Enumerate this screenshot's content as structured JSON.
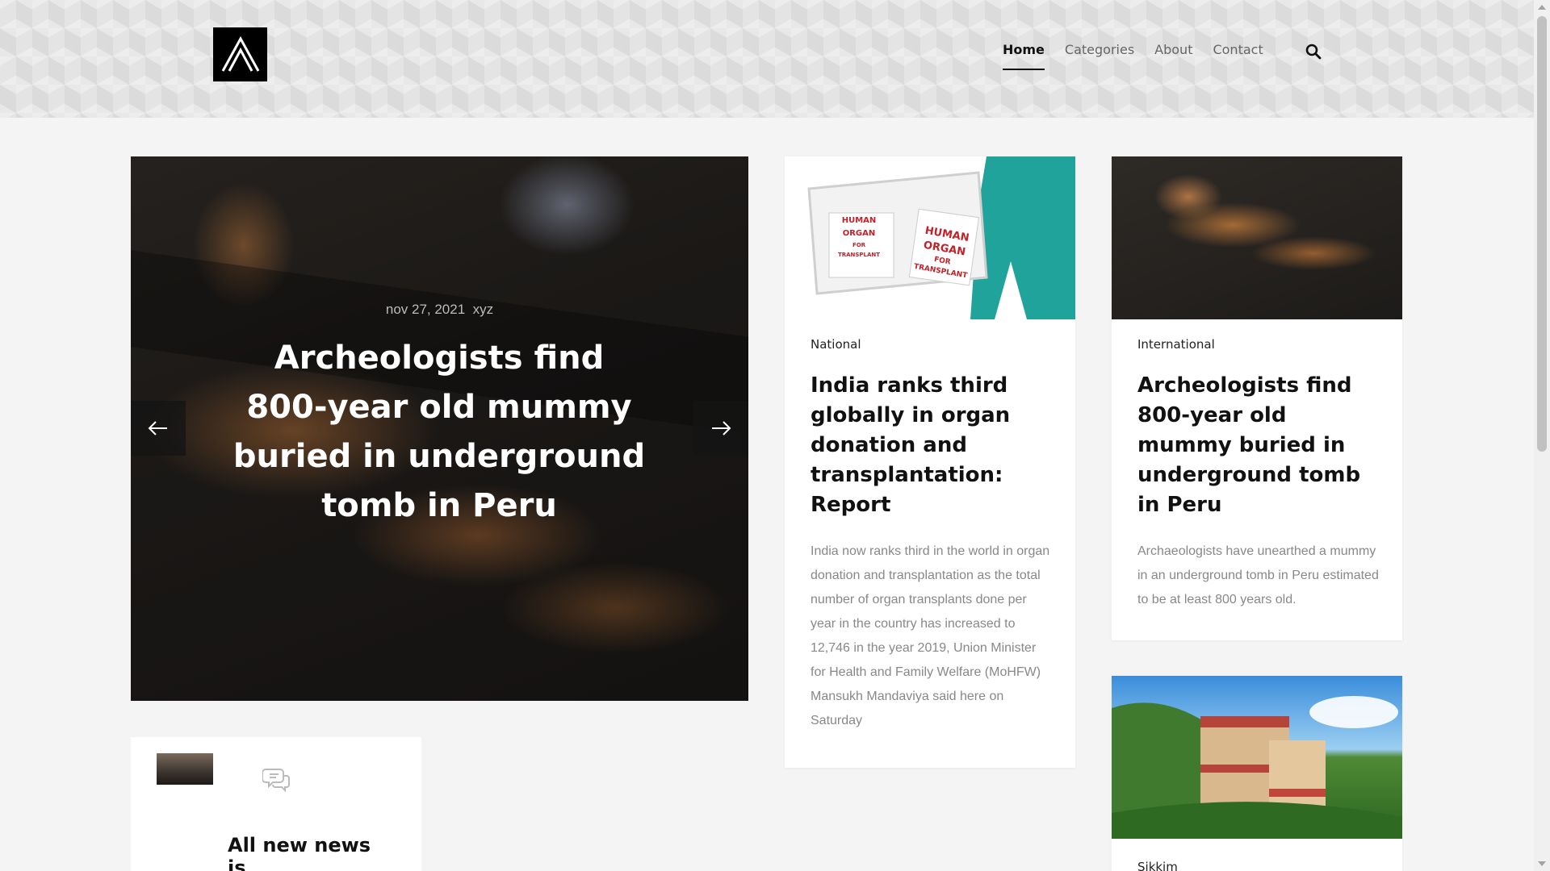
{
  "nav": {
    "items": [
      {
        "label": "Home",
        "active": true
      },
      {
        "label": "Categories",
        "active": false
      },
      {
        "label": "About",
        "active": false
      },
      {
        "label": "Contact",
        "active": false
      }
    ],
    "search_icon": "search-icon"
  },
  "hero": {
    "date": "nov 27, 2021",
    "author": "xyz",
    "title": "Archeologists find 800-year old mummy buried in underground tomb in Peru",
    "prev_icon": "arrow-left-icon",
    "next_icon": "arrow-right-icon"
  },
  "cards": [
    {
      "category": "National",
      "title": "India ranks third globally in organ donation and transplantation: Report",
      "excerpt": "India now ranks third in the world in organ donation and transplantation as the total number of organ transplants done per year in the country has increased to 12,746 in the year 2019, Union Minister for Health and Family Welfare (MoHFW) Mansukh Mandaviya said here on Saturday",
      "image_text_1": "HUMAN ORGAN FOR TRANSPLANT",
      "image_text_2": "HUMAN ORGAN FOR TRANSPLANT"
    },
    {
      "category": "International",
      "title": "Archeologists find 800-year old mummy buried in underground tomb in Peru",
      "excerpt": "Archaeologists have unearthed a mummy in an underground tomb in Peru estimated to be at least 800 years old."
    },
    {
      "category": "Sikkim"
    }
  ],
  "widget": {
    "title": "All new news is",
    "icon": "chat-bubbles-icon"
  },
  "colors": {
    "accent": "#111111",
    "nav_inactive": "#666666",
    "excerpt": "#888888",
    "page_bg": "#f4f4f4"
  }
}
